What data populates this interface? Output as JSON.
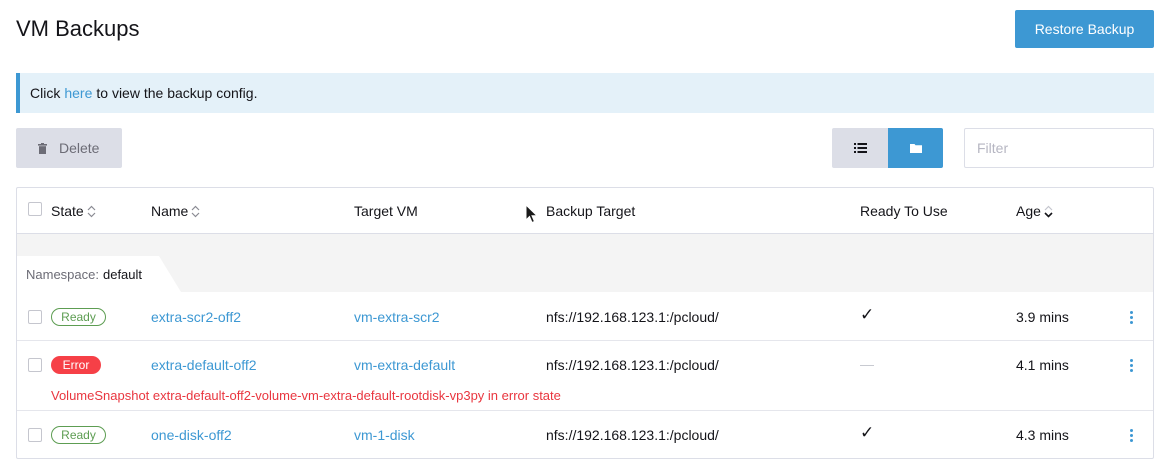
{
  "header": {
    "title": "VM Backups",
    "restore_label": "Restore Backup"
  },
  "banner": {
    "prefix": "Click",
    "link": "here",
    "suffix": "to view the backup config."
  },
  "toolbar": {
    "delete_label": "Delete",
    "filter_placeholder": "Filter",
    "active_view": "folder"
  },
  "columns": {
    "state": "State",
    "name": "Name",
    "target_vm": "Target VM",
    "backup_target": "Backup Target",
    "ready": "Ready To Use",
    "age": "Age"
  },
  "group": {
    "label": "Namespace:",
    "value": "default"
  },
  "rows": [
    {
      "state": "Ready",
      "name": "extra-scr2-off2",
      "target_vm": "vm-extra-scr2",
      "backup_target": "nfs://192.168.123.1:/pcloud/",
      "ready": "✓",
      "age": "3.9 mins"
    },
    {
      "state": "Error",
      "name": "extra-default-off2",
      "target_vm": "vm-extra-default",
      "backup_target": "nfs://192.168.123.1:/pcloud/",
      "ready": "—",
      "age": "4.1 mins",
      "error": "VolumeSnapshot extra-default-off2-volume-vm-extra-default-rootdisk-vp3py in error state"
    },
    {
      "state": "Ready",
      "name": "one-disk-off2",
      "target_vm": "vm-1-disk",
      "backup_target": "nfs://192.168.123.1:/pcloud/",
      "ready": "✓",
      "age": "4.3 mins"
    }
  ],
  "colors": {
    "primary": "#3d98d3",
    "success": "#5d9d52",
    "error": "#f64047"
  }
}
